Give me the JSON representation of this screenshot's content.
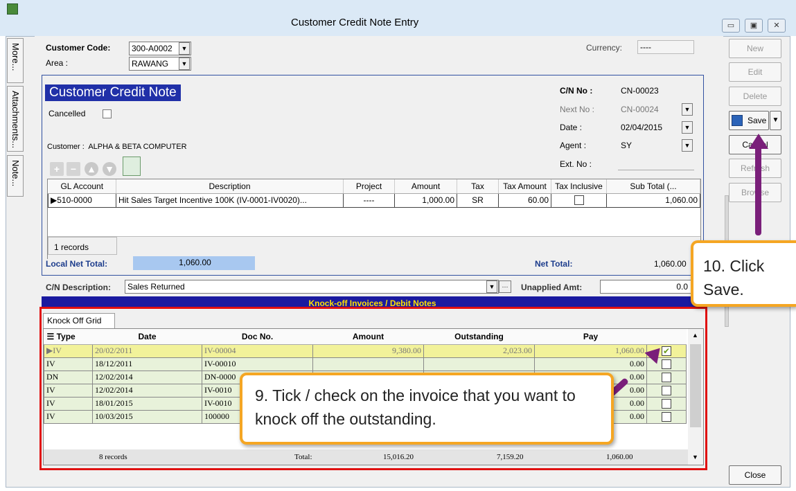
{
  "window": {
    "title": "Customer Credit Note Entry",
    "min_glyph": "▭",
    "max_glyph": "▣",
    "close_glyph": "✕"
  },
  "side_tabs": [
    "More...",
    "Attachments...",
    "Note..."
  ],
  "header": {
    "customer_code_label": "Customer Code:",
    "customer_code": "300-A0002",
    "area_label": "Area :",
    "area": "RAWANG",
    "currency_label": "Currency:",
    "currency": "----"
  },
  "form": {
    "heading": "Customer Credit Note",
    "cancelled_label": "Cancelled",
    "customer_label": "Customer :",
    "customer_name": "ALPHA & BETA COMPUTER",
    "cn_no_label": "C/N No :",
    "cn_no": "CN-00023",
    "next_no_label": "Next No :",
    "next_no": "CN-00024",
    "date_label": "Date :",
    "date": "02/04/2015",
    "agent_label": "Agent :",
    "agent": "SY",
    "ext_no_label": "Ext. No :"
  },
  "detail_grid": {
    "columns": [
      "GL Account",
      "Description",
      "Project",
      "Amount",
      "Tax",
      "Tax Amount",
      "Tax Inclusive",
      "Sub Total (..."
    ],
    "rows": [
      {
        "gl": "510-0000",
        "desc": "Hit Sales Target Incentive 100K (IV-0001-IV0020)...",
        "project": "----",
        "amount": "1,000.00",
        "tax": "SR",
        "tax_amount": "60.00",
        "sub_total": "1,060.00"
      }
    ],
    "records": "1 records"
  },
  "totals": {
    "local_net_label": "Local Net Total:",
    "local_net": "1,060.00",
    "net_label": "Net Total:",
    "net": "1,060.00",
    "description_label": "C/N Description:",
    "description": "Sales Returned",
    "unapplied_label": "Unapplied Amt:",
    "unapplied": "0.0"
  },
  "knockoff": {
    "title": "Knock-off Invoices / Debit Notes",
    "tab": "Knock Off Grid",
    "columns": [
      "Type",
      "Date",
      "Doc No.",
      "Amount",
      "Outstanding",
      "Pay"
    ],
    "rows": [
      {
        "type": "IV",
        "date": "20/02/2011",
        "doc": "IV-00004",
        "amount": "9,380.00",
        "outstanding": "2,023.00",
        "pay": "1,060.00",
        "checked": true
      },
      {
        "type": "IV",
        "date": "18/12/2011",
        "doc": "IV-00010",
        "amount": "",
        "outstanding": "",
        "pay": "0.00",
        "checked": false
      },
      {
        "type": "DN",
        "date": "12/02/2014",
        "doc": "DN-0000",
        "amount": "",
        "outstanding": "",
        "pay": "0.00",
        "checked": false
      },
      {
        "type": "IV",
        "date": "12/02/2014",
        "doc": "IV-0010",
        "amount": "",
        "outstanding": "",
        "pay": "0.00",
        "checked": false
      },
      {
        "type": "IV",
        "date": "18/01/2015",
        "doc": "IV-0010",
        "amount": "",
        "outstanding": "",
        "pay": "0.00",
        "checked": false
      },
      {
        "type": "IV",
        "date": "10/03/2015",
        "doc": "100000",
        "amount": "",
        "outstanding": "",
        "pay": "0.00",
        "checked": false
      }
    ],
    "records": "8 records",
    "total_label": "Total:",
    "total_amount": "15,016.20",
    "total_outstanding": "7,159.20",
    "total_pay": "1,060.00"
  },
  "buttons": {
    "new": "New",
    "edit": "Edit",
    "delete": "Delete",
    "save": "Save",
    "cancel": "Cancel",
    "refresh": "Refresh",
    "browse": "Browse",
    "close": "Close"
  },
  "callouts": {
    "step10": "10. Click Save.",
    "step9": "9. Tick / check on the invoice that you want to knock off the outstanding."
  },
  "colors": {
    "heading_bg": "#2030a8",
    "highlight": "#f2f29a",
    "red_frame": "#e01010",
    "callout_border": "#f5a623",
    "arrow": "#7a1f7a"
  }
}
